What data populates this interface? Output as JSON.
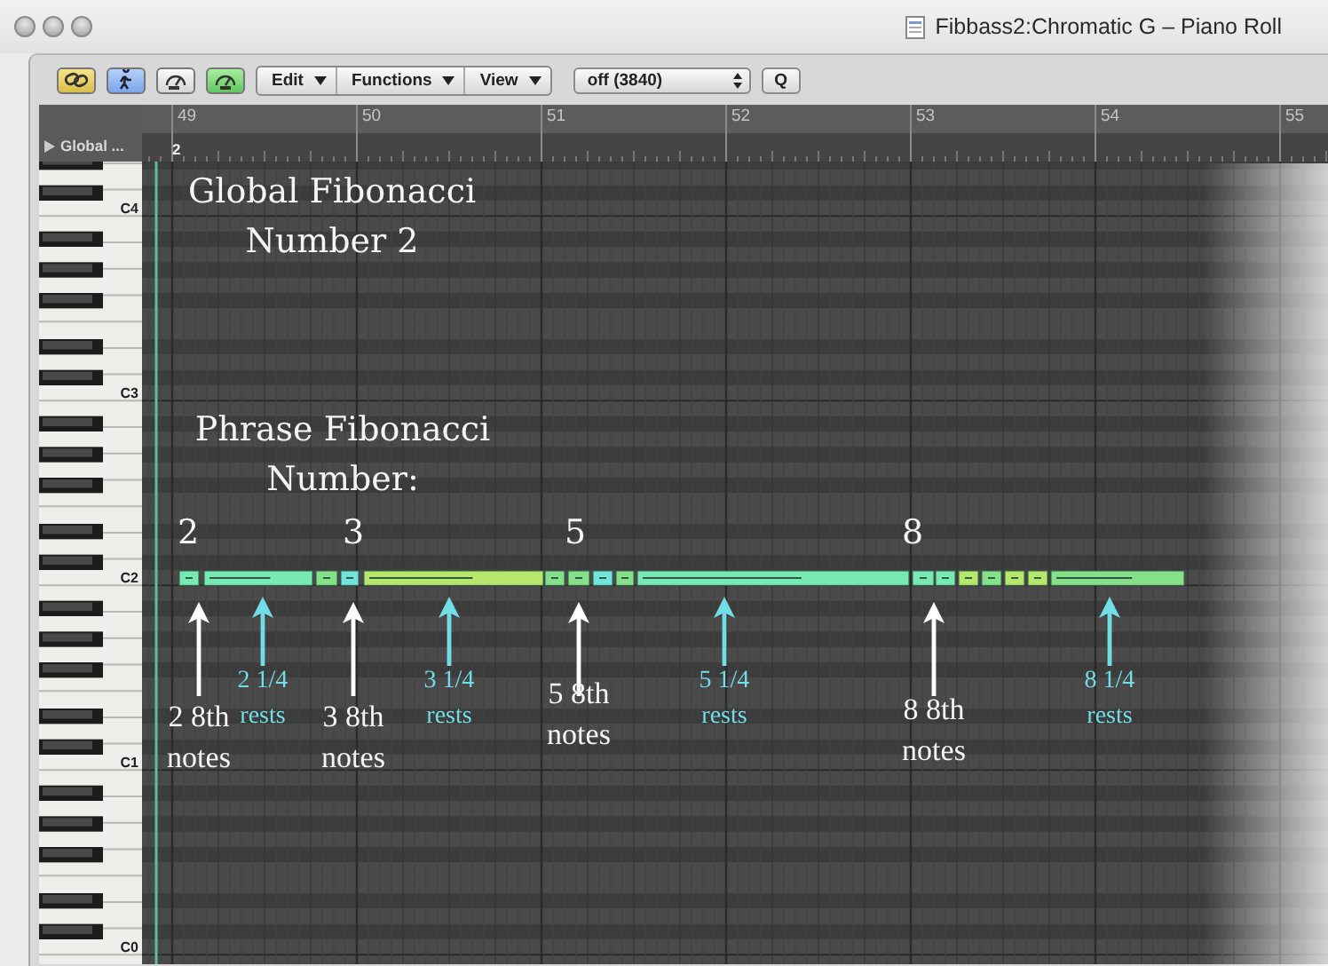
{
  "window": {
    "title": "Fibbass2:Chromatic G – Piano Roll"
  },
  "toolbar": {
    "toggles": [
      {
        "kind": "link",
        "on": true
      },
      {
        "kind": "catch",
        "on": true
      },
      {
        "kind": "midi_in",
        "on": false
      },
      {
        "kind": "midi_out",
        "on": true
      }
    ],
    "menus": [
      "Edit",
      "Functions",
      "View"
    ],
    "quantize": {
      "value": "off (3840)"
    },
    "search_button": "Q"
  },
  "ruler": {
    "bars": [
      "49",
      "50",
      "51",
      "52",
      "53",
      "54",
      "55"
    ],
    "global_tracks": "Global ...",
    "marker": "2"
  },
  "keyboard": {
    "labels": [
      "C4",
      "C3",
      "C2",
      "C1",
      "C0"
    ]
  },
  "annotations": {
    "heading": "Global Fibonacci Number 2",
    "subheading": "Phrase Fibonacci Number:",
    "phrases": [
      {
        "number": "2",
        "notes": "2 8th notes",
        "rests": "2 1/4 rests"
      },
      {
        "number": "3",
        "notes": "3 8th notes",
        "rests": "3 1/4 rests"
      },
      {
        "number": "5",
        "notes": "5 8th notes",
        "rests": "5 1/4 rests"
      },
      {
        "number": "8",
        "notes": "8 8th notes",
        "rests": "8 1/4 rests"
      }
    ]
  }
}
